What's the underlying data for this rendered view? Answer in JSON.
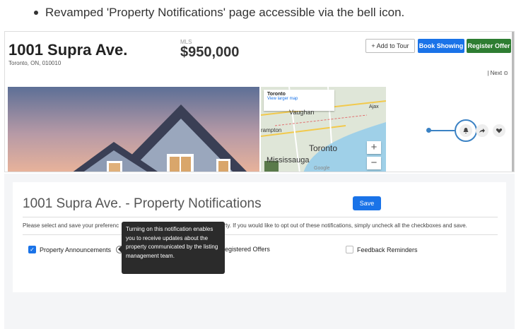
{
  "caption": {
    "text": "Revamped 'Property Notifications' page accessible via the bell icon."
  },
  "listing": {
    "address": "1001 Supra Ave.",
    "sub_address": "Toronto, ON, 010010",
    "mls_label": "MLS",
    "price": "$950,000",
    "buttons": {
      "add_to_tour": "+ Add to Tour",
      "book_showing": "Book Showing",
      "register_offer": "Register Offer"
    },
    "next_label": "| Next ⊙",
    "icons": [
      "bell-icon",
      "share-icon",
      "heart-icon"
    ],
    "map": {
      "card_title": "Toronto",
      "card_link": "View larger map",
      "labels": {
        "vaughan": "Vaughan",
        "brampton": "rampton",
        "toronto": "Toronto",
        "mississauga": "Mississauga",
        "ajax": "Ajax",
        "google": "Google"
      },
      "zoom_plus": "+",
      "zoom_minus": "−"
    }
  },
  "notifications": {
    "title": "1001 Supra Ave. - Property Notifications",
    "save_label": "Save",
    "instructions_start": "Please select and save your preferenc",
    "instructions_end": "operty. If you would like to opt out of these notifications, simply uncheck all the checkboxes and save.",
    "options": [
      {
        "label": "Property Announcements",
        "checked": true
      },
      {
        "label": "egistered Offers",
        "checked": false
      },
      {
        "label": "Feedback Reminders",
        "checked": false
      }
    ],
    "tooltip": "Turning on this notification enables you to receive updates about the property communicated by the listing management team."
  },
  "colors": {
    "primary_blue": "#1a73e8",
    "register_green": "#2e7d32",
    "annotation_blue": "#3b82c4"
  }
}
